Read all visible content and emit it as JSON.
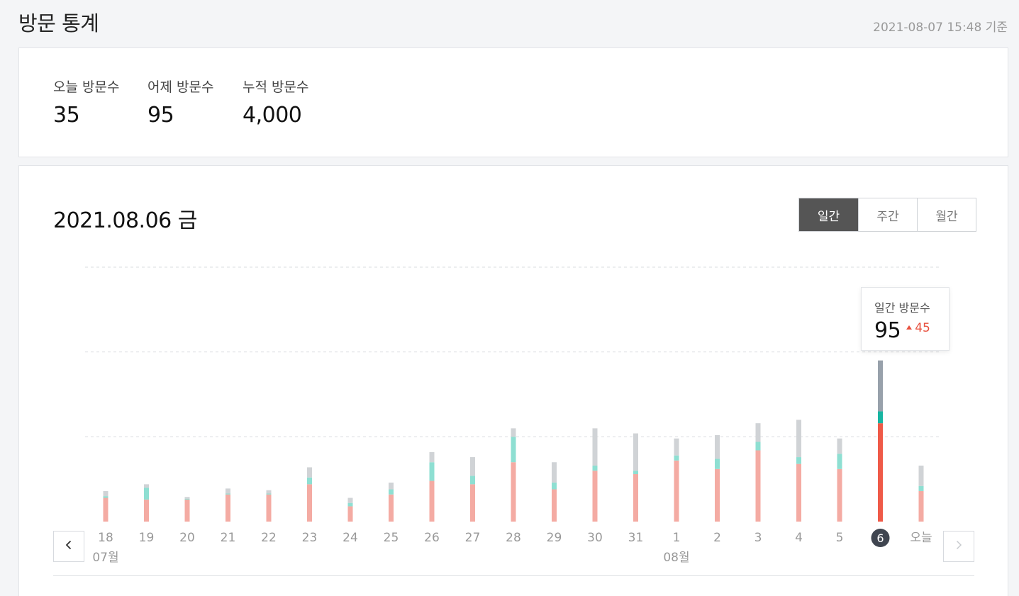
{
  "header": {
    "title": "방문 통계",
    "timestamp": "2021-08-07 15:48 기준"
  },
  "summary": {
    "stats": [
      {
        "label": "오늘 방문수",
        "value": "35"
      },
      {
        "label": "어제 방문수",
        "value": "95"
      },
      {
        "label": "누적 방문수",
        "value": "4,000"
      }
    ]
  },
  "chart_panel": {
    "date_title": "2021.08.06 금",
    "tabs": [
      {
        "label": "일간",
        "active": true
      },
      {
        "label": "주간",
        "active": false
      },
      {
        "label": "월간",
        "active": false
      }
    ],
    "prev_icon": "chevron-left-icon",
    "next_icon": "chevron-right-icon",
    "tooltip": {
      "label": "일간 방문수",
      "value": "95",
      "change": "45",
      "change_icon": "triangle-up-icon"
    }
  },
  "chart_data": {
    "type": "bar",
    "stacked": true,
    "categories": [
      "18",
      "19",
      "20",
      "21",
      "22",
      "23",
      "24",
      "25",
      "26",
      "27",
      "28",
      "29",
      "30",
      "31",
      "1",
      "2",
      "3",
      "4",
      "5",
      "6",
      "오늘"
    ],
    "month_labels": [
      {
        "label": "07월",
        "category_index": 0
      },
      {
        "label": "08월",
        "category_index": 14
      }
    ],
    "selected_index": 19,
    "series": [
      {
        "key": "red",
        "values": [
          14,
          13,
          13,
          16,
          16,
          22,
          9,
          16,
          24,
          22,
          35,
          19,
          30,
          28,
          36,
          31,
          42,
          34,
          31,
          58,
          18
        ]
      },
      {
        "key": "teal",
        "values": [
          1,
          7,
          0.5,
          0.5,
          0.5,
          4,
          2,
          3,
          11,
          5,
          15,
          4,
          3,
          2,
          3,
          6,
          5,
          4,
          9,
          7,
          3
        ]
      },
      {
        "key": "gray",
        "values": [
          3,
          2,
          1,
          3,
          2,
          6,
          3,
          4,
          6,
          11,
          5,
          12,
          22,
          22,
          10,
          14,
          11,
          22,
          9,
          30,
          12
        ]
      }
    ],
    "colors": {
      "red": "#f4aba3",
      "teal": "#8edfd2",
      "gray": "#d0d3d6",
      "red_selected": "#ef5a48",
      "teal_selected": "#17b5a2",
      "gray_selected": "#98a1ab",
      "grid": "#d9dcdf",
      "label": "#999999",
      "selected_circle": "#3f4550"
    },
    "ylim": [
      0,
      150
    ],
    "gridlines": [
      50,
      100,
      150
    ],
    "grid": true,
    "legend": false
  }
}
